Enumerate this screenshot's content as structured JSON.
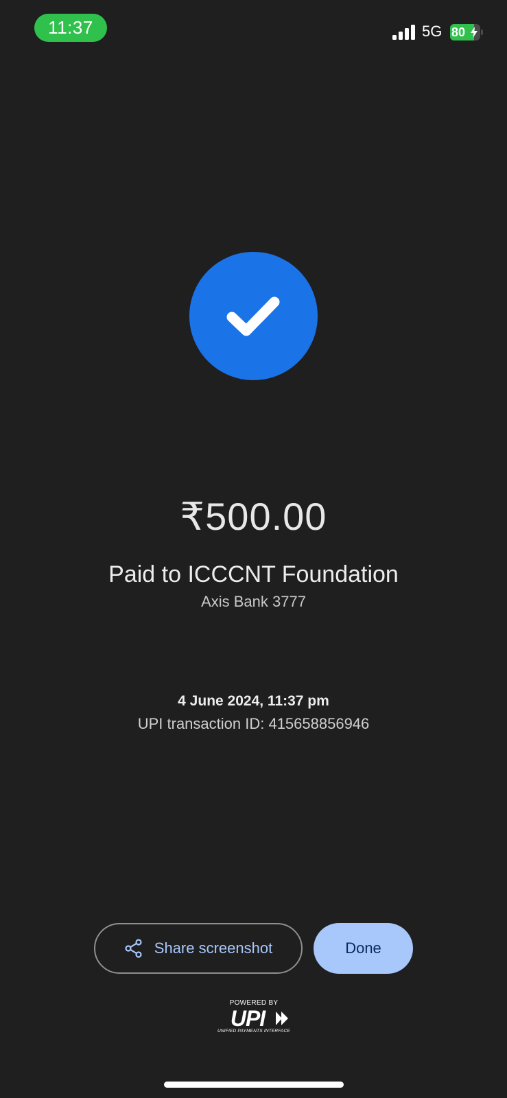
{
  "status_bar": {
    "time": "11:37",
    "network": "5G",
    "battery_percent": "80",
    "battery_level": 0.8,
    "charging": true,
    "time_pill_color": "#30c14d"
  },
  "success": {
    "icon": "check-icon",
    "circle_color": "#1b73e8"
  },
  "payment": {
    "amount": "₹500.00",
    "payee": "Paid to ICCCNT Foundation",
    "bank": "Axis Bank 3777",
    "datetime": "4 June 2024, 11:37 pm",
    "transaction_id": "UPI transaction ID: 415658856946"
  },
  "actions": {
    "share_label": "Share screenshot",
    "share_icon": "share-icon",
    "done_label": "Done",
    "accent_color": "#a8c7fa"
  },
  "footer": {
    "powered_by": "POWERED BY",
    "upi_wordmark": "UPI",
    "upi_tagline": "UNIFIED PAYMENTS INTERFACE"
  }
}
